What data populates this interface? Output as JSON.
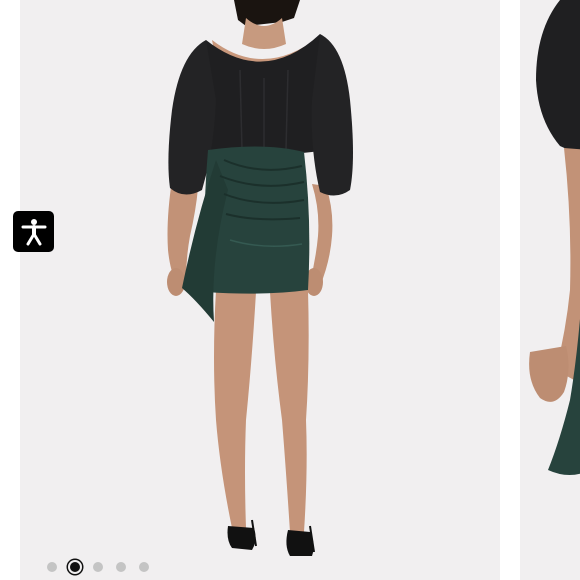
{
  "carousel": {
    "current_slide": 2,
    "total_slides": 5,
    "dots": [
      {
        "active": false
      },
      {
        "active": true
      },
      {
        "active": false
      },
      {
        "active": false
      },
      {
        "active": false
      }
    ]
  },
  "accessibility": {
    "icon": "accessibility-person-icon"
  },
  "colors": {
    "background": "#f1eff0",
    "top_garment": "#1e1e20",
    "skirt": "#27433d",
    "skin": "#c79a7f",
    "dot_inactive": "#c4c4c4",
    "dot_active": "#111111"
  }
}
